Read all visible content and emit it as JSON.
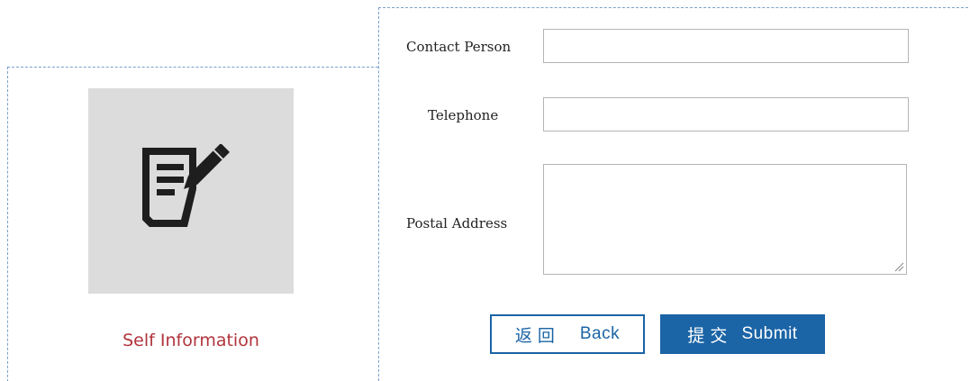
{
  "left_card": {
    "icon": "edit-document-icon",
    "caption": "Self Information",
    "caption_color": "#b0343c",
    "tile_color": "#dcdcdc"
  },
  "form": {
    "contact_person": {
      "label": "Contact Person",
      "value": ""
    },
    "telephone": {
      "label": "Telephone",
      "value": ""
    },
    "postal_address": {
      "label": "Postal Address",
      "value": ""
    }
  },
  "buttons": {
    "back": {
      "cn_label": "返回",
      "en_label": "Back"
    },
    "submit": {
      "cn_label": "提交",
      "en_label": "Submit"
    },
    "accent_color": "#1b64a6"
  }
}
